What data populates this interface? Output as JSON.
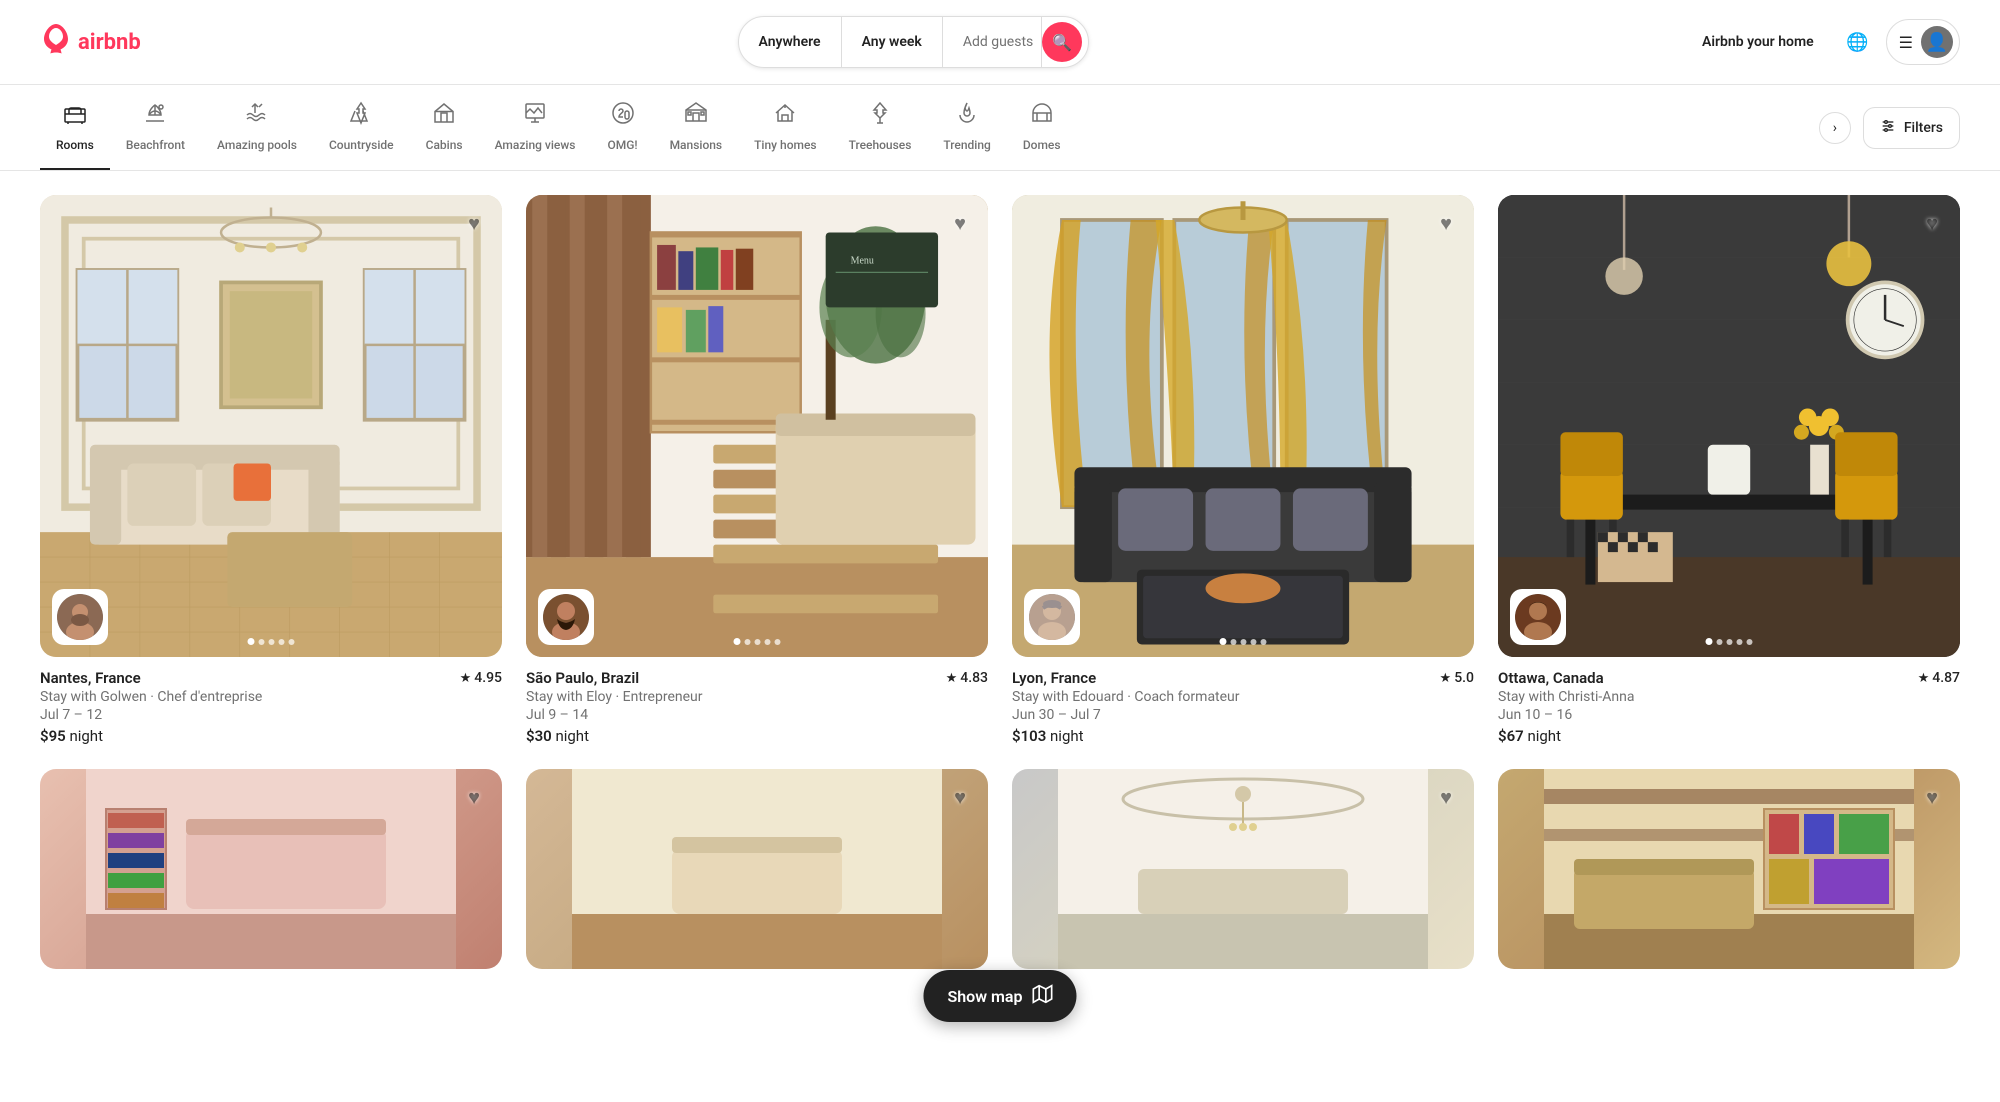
{
  "header": {
    "logo_text": "airbnb",
    "airbnb_home_label": "Airbnb your home",
    "search": {
      "location_placeholder": "Anywhere",
      "week_placeholder": "Any week",
      "guests_placeholder": "Add guests"
    }
  },
  "categories": [
    {
      "id": "rooms",
      "label": "Rooms",
      "icon": "🛏️",
      "active": true
    },
    {
      "id": "beachfront",
      "label": "Beachfront",
      "icon": "🏖️",
      "active": false
    },
    {
      "id": "amazing-pools",
      "label": "Amazing pools",
      "icon": "🏊",
      "active": false
    },
    {
      "id": "countryside",
      "label": "Countryside",
      "icon": "🌲",
      "active": false
    },
    {
      "id": "cabins",
      "label": "Cabins",
      "icon": "🏠",
      "active": false
    },
    {
      "id": "amazing-views",
      "label": "Amazing views",
      "icon": "🖼️",
      "active": false
    },
    {
      "id": "omg",
      "label": "OMG!",
      "icon": "🛸",
      "active": false
    },
    {
      "id": "mansions",
      "label": "Mansions",
      "icon": "🏰",
      "active": false
    },
    {
      "id": "tiny-homes",
      "label": "Tiny homes",
      "icon": "🏡",
      "active": false
    },
    {
      "id": "treehouses",
      "label": "Treehouses",
      "icon": "🌳",
      "active": false
    },
    {
      "id": "trending",
      "label": "Trending",
      "icon": "🔥",
      "active": false
    },
    {
      "id": "domes",
      "label": "Domes",
      "icon": "⛺",
      "active": false
    }
  ],
  "filters_label": "Filters",
  "listings": [
    {
      "id": "nantes",
      "location": "Nantes, France",
      "rating": "4.95",
      "subtitle": "Stay with Golwen · Chef d'entreprise",
      "dates": "Jul 7 – 12",
      "price": "$95",
      "price_unit": "night",
      "img_class": "img-nantes",
      "dots": 5,
      "active_dot": 0
    },
    {
      "id": "saopaulo",
      "location": "São Paulo, Brazil",
      "rating": "4.83",
      "subtitle": "Stay with Eloy · Entrepreneur",
      "dates": "Jul 9 – 14",
      "price": "$30",
      "price_unit": "night",
      "img_class": "img-saopaulo",
      "dots": 5,
      "active_dot": 0
    },
    {
      "id": "lyon",
      "location": "Lyon, France",
      "rating": "5.0",
      "subtitle": "Stay with Edouard · Coach formateur",
      "dates": "Jun 30 – Jul 7",
      "price": "$103",
      "price_unit": "night",
      "img_class": "img-lyon",
      "dots": 5,
      "active_dot": 0
    },
    {
      "id": "ottawa",
      "location": "Ottawa, Canada",
      "rating": "4.87",
      "subtitle": "Stay with Christi-Anna",
      "dates": "Jun 10 – 16",
      "price": "$67",
      "price_unit": "night",
      "img_class": "img-ottawa",
      "dots": 5,
      "active_dot": 0
    }
  ],
  "partial_listings": [
    {
      "id": "p1",
      "img_class": "img-partial1"
    },
    {
      "id": "p2",
      "img_class": "img-partial2"
    },
    {
      "id": "p3",
      "img_class": "img-partial3"
    },
    {
      "id": "p4",
      "img_class": "img-partial4"
    }
  ],
  "show_map_label": "Show map"
}
